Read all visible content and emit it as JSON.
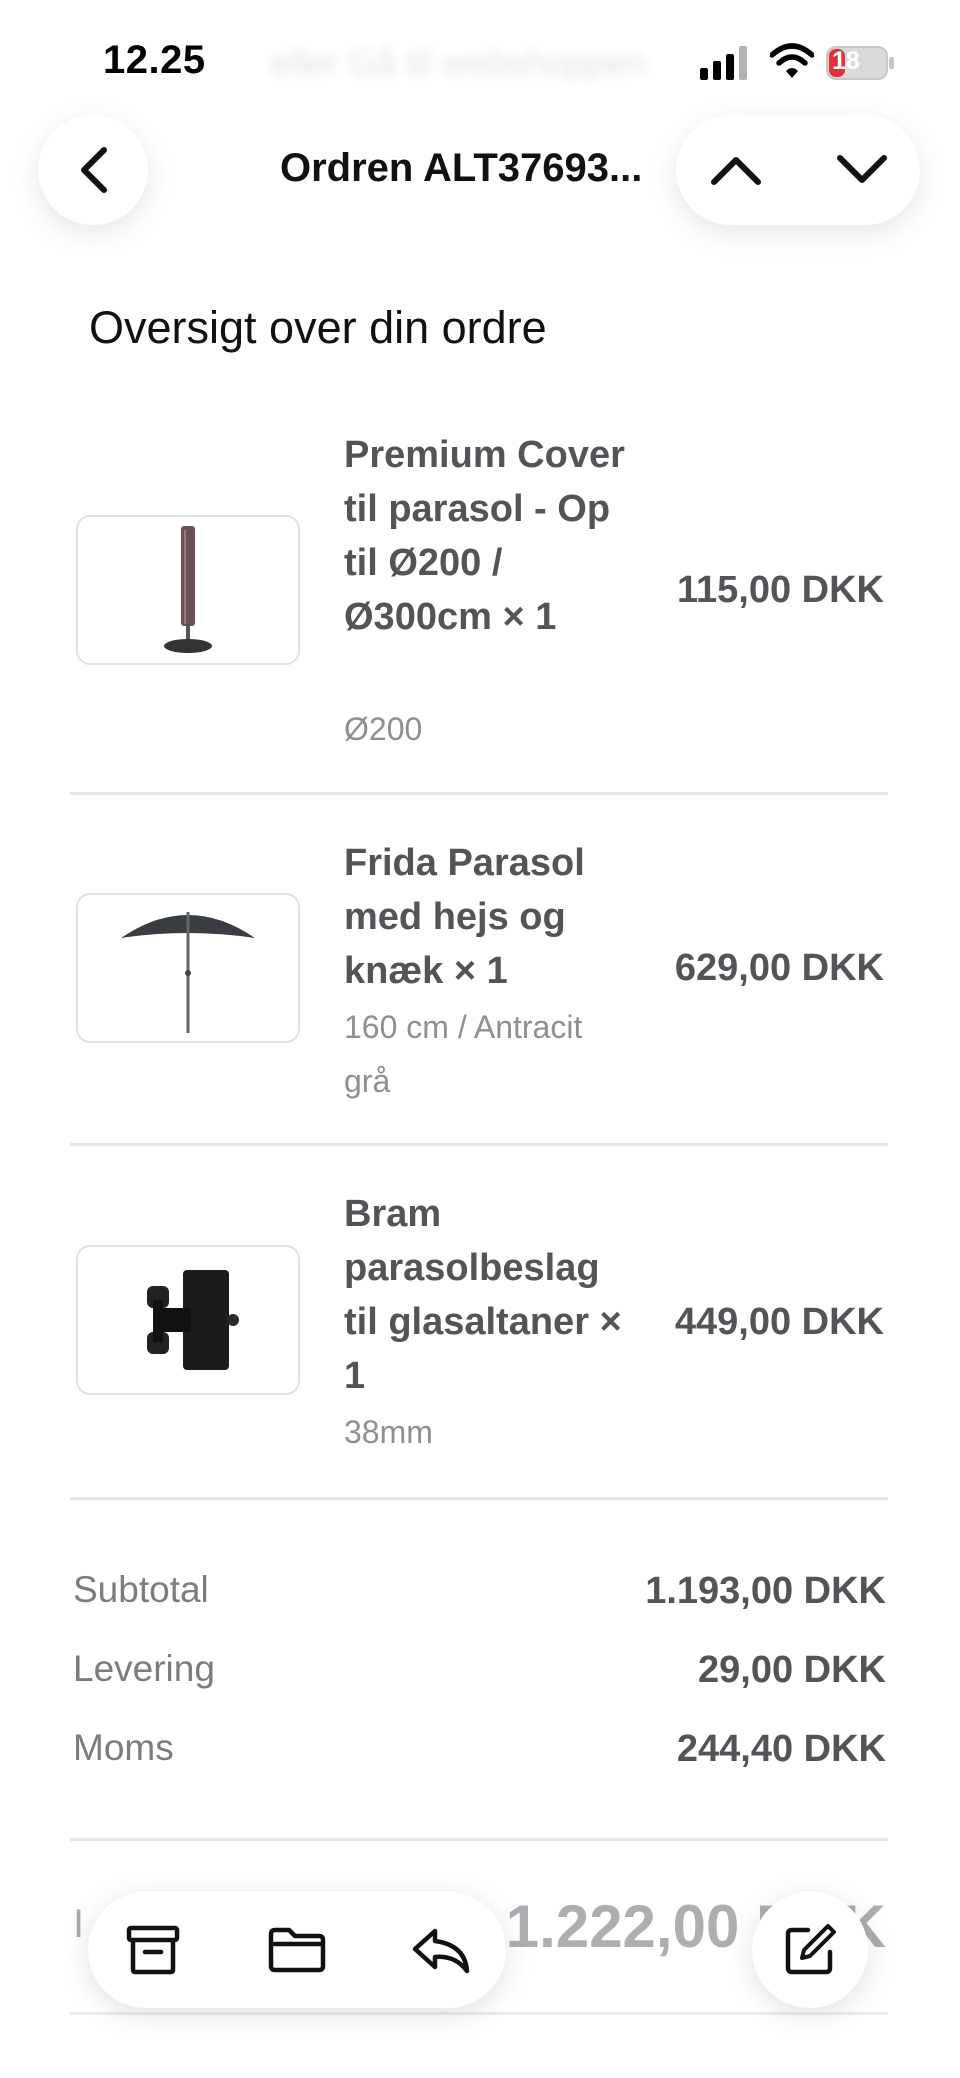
{
  "status_bar": {
    "time": "12.25",
    "background_text": "eller Gå til webshoppen",
    "battery": "18"
  },
  "nav": {
    "title": "Ordren ALT37693..."
  },
  "section_title": "Oversigt over din ordre",
  "items": [
    {
      "name": "Premium Cover til parasol - Op til Ø200 / Ø300cm × 1",
      "variant": "Ø200",
      "price": "115,00 DKK",
      "image_icon": "parasol-cover-image"
    },
    {
      "name": "Frida Parasol med hejs og knæk × 1",
      "variant": "160 cm / Antracit grå",
      "price": "629,00 DKK",
      "image_icon": "parasol-image"
    },
    {
      "name": "Bram parasolbeslag til glasaltaner × 1",
      "variant": "38mm",
      "price": "449,00 DKK",
      "image_icon": "bracket-image"
    }
  ],
  "summary": {
    "subtotal_label": "Subtotal",
    "subtotal_value": "1.193,00 DKK",
    "delivery_label": "Levering",
    "delivery_value": "29,00 DKK",
    "vat_label": "Moms",
    "vat_value": "244,40 DKK"
  },
  "total": {
    "label": "I",
    "value": "1.222,00 DKK"
  },
  "toolbar": {
    "archive_icon": "archive-icon",
    "folder_icon": "folder-icon",
    "reply_icon": "reply-icon",
    "compose_icon": "compose-icon"
  }
}
